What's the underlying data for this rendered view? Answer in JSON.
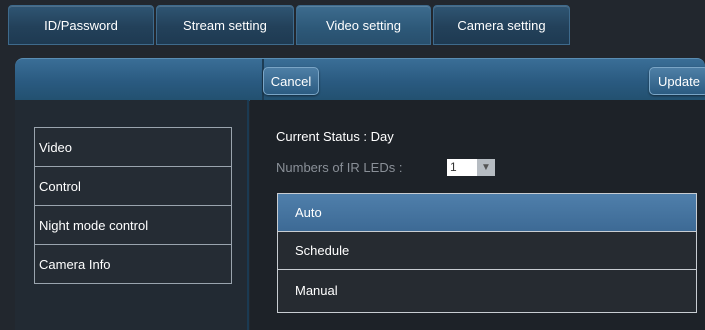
{
  "tabs": [
    {
      "label": "ID/Password"
    },
    {
      "label": "Stream setting"
    },
    {
      "label": "Video setting",
      "active": true
    },
    {
      "label": "Camera setting"
    }
  ],
  "toolbar": {
    "cancel_label": "Cancel",
    "update_label": "Update"
  },
  "sidebar": {
    "items": [
      {
        "label": "Video"
      },
      {
        "label": "Control"
      },
      {
        "label": "Night mode control"
      },
      {
        "label": "Camera Info"
      }
    ]
  },
  "content": {
    "current_status": "Current Status : Day",
    "ir_leds_label": "Numbers of IR LEDs :",
    "ir_leds_value": "1",
    "mode_options": [
      {
        "label": "Auto",
        "selected": true
      },
      {
        "label": "Schedule"
      },
      {
        "label": "Manual"
      }
    ]
  },
  "colors": {
    "accent": "#3d6a95",
    "tab_active": "#2d5878",
    "background": "#22272e"
  },
  "icons": {
    "dropdown": "chevron-down-icon"
  }
}
